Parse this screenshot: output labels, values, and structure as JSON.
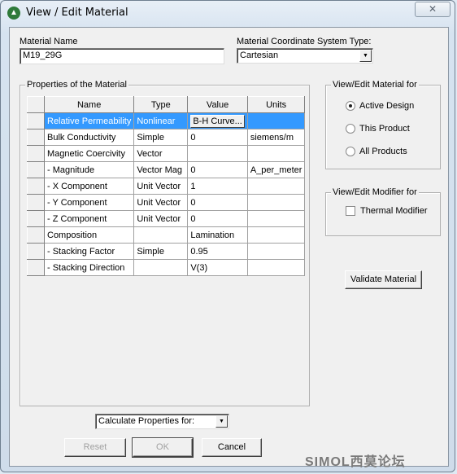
{
  "window": {
    "title": "View / Edit Material",
    "close_glyph": "✕",
    "icon": "ansoft-logo-icon"
  },
  "material_name": {
    "label": "Material Name",
    "value": "M19_29G"
  },
  "coordinate_system": {
    "label": "Material Coordinate System Type:",
    "value": "Cartesian"
  },
  "properties": {
    "group_label": "Properties of the Material",
    "columns": [
      "Name",
      "Type",
      "Value",
      "Units"
    ],
    "selected_row": 0,
    "rows": [
      {
        "name": "Relative Permeability",
        "type": "Nonlinear",
        "value": "B-H Curve...",
        "units": "",
        "value_is_button": true
      },
      {
        "name": "Bulk Conductivity",
        "type": "Simple",
        "value": "0",
        "units": "siemens/m"
      },
      {
        "name": "Magnetic Coercivity",
        "type": "Vector",
        "value": "",
        "units": ""
      },
      {
        "name": "-  Magnitude",
        "type": "Vector Mag",
        "value": "0",
        "units": "A_per_meter"
      },
      {
        "name": "-  X Component",
        "type": "Unit Vector",
        "value": "1",
        "units": ""
      },
      {
        "name": "-  Y Component",
        "type": "Unit Vector",
        "value": "0",
        "units": ""
      },
      {
        "name": "-  Z Component",
        "type": "Unit Vector",
        "value": "0",
        "units": ""
      },
      {
        "name": "Composition",
        "type": "",
        "value": "Lamination",
        "units": ""
      },
      {
        "name": "- Stacking Factor",
        "type": "Simple",
        "value": "0.95",
        "units": ""
      },
      {
        "name": "- Stacking Direction",
        "type": "",
        "value": "V(3)",
        "units": ""
      }
    ]
  },
  "view_edit_for": {
    "label": "View/Edit Material for",
    "options": [
      "Active Design",
      "This Product",
      "All Products"
    ],
    "selected": "Active Design"
  },
  "modifier_for": {
    "label": "View/Edit Modifier for",
    "thermal_modifier": {
      "label": "Thermal Modifier",
      "checked": false
    }
  },
  "validate_label": "Validate Material",
  "calculate": {
    "value": "Calculate Properties for:"
  },
  "buttons": {
    "reset": "Reset",
    "ok": "OK",
    "cancel": "Cancel"
  },
  "watermark": "SIMOL西莫论坛"
}
